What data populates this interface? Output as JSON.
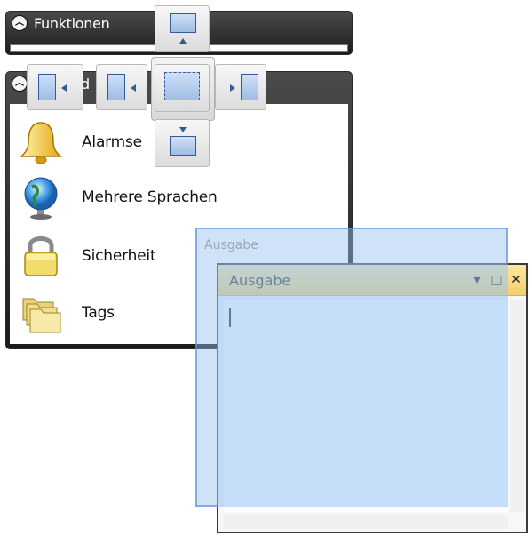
{
  "panels": {
    "functions": {
      "title": "Funktionen"
    },
    "features_title_visible": "d",
    "features": [
      {
        "label": "Alarmse",
        "icon": "bell-icon"
      },
      {
        "label": "Mehrere Sprachen",
        "icon": "globe-icon"
      },
      {
        "label": "Sicherheit",
        "icon": "padlock-icon"
      },
      {
        "label": "Tags",
        "icon": "folders-icon"
      }
    ]
  },
  "dock_guide": {
    "targets": [
      "dock-top",
      "dock-left-outer",
      "dock-left-inner",
      "dock-center",
      "dock-right",
      "dock-bottom"
    ]
  },
  "output_window": {
    "title": "Ausgabe",
    "ghost_title": "Ausgabe",
    "buttons": {
      "menu": "▾",
      "maximize": "□",
      "close": "✕"
    },
    "text": ""
  },
  "colors": {
    "panel_header": "#2b2b2b",
    "tool_titlebar": "#f3cf6c",
    "drag_overlay": "#9fc3f0"
  }
}
